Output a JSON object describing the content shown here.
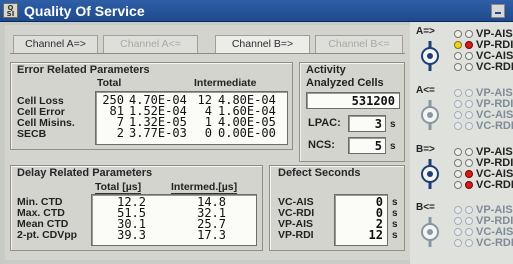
{
  "window": {
    "title": "Quality Of Service",
    "icon_text": "Q\nSI"
  },
  "tabs": [
    {
      "label": "Channel A=>",
      "state": "normal"
    },
    {
      "label": "Channel A<=",
      "state": "disabled"
    },
    {
      "label": "Channel B=>",
      "state": "active"
    },
    {
      "label": "Channel B<=",
      "state": "disabled"
    }
  ],
  "error": {
    "title": "Error Related Parameters",
    "col_total": "Total",
    "col_intermediate": "Intermediate",
    "rows": [
      {
        "label": "Cell Loss",
        "total_count": "250",
        "total_rate": "4.70E-04",
        "inter_count": "12",
        "inter_rate": "4.80E-04"
      },
      {
        "label": "Cell Error",
        "total_count": "81",
        "total_rate": "1.52E-04",
        "inter_count": "4",
        "inter_rate": "1.60E-04"
      },
      {
        "label": "Cell Misins.",
        "total_count": "7",
        "total_rate": "1.32E-05",
        "inter_count": "1",
        "inter_rate": "4.00E-05"
      },
      {
        "label": "SECB",
        "total_count": "2",
        "total_rate": "3.77E-03",
        "inter_count": "0",
        "inter_rate": "0.00E-00"
      }
    ]
  },
  "activity": {
    "title": "Activity",
    "analyzed_label": "Analyzed Cells",
    "analyzed_value": "531200",
    "lpac_label": "LPAC:",
    "lpac_value": "3",
    "ncs_label": "NCS:",
    "ncs_value": "5",
    "unit": "s"
  },
  "delay": {
    "title": "Delay Related Parameters",
    "col_total": "Total [µs]",
    "col_intermediate": "Intermed.[µs]",
    "rows": [
      {
        "label": "Min. CTD",
        "total": "12.2",
        "inter": "14.8"
      },
      {
        "label": "Max. CTD",
        "total": "51.5",
        "inter": "32.1"
      },
      {
        "label": "Mean CTD",
        "total": "30.1",
        "inter": "25.7"
      },
      {
        "label": "2-pt. CDVpp",
        "total": "39.3",
        "inter": "17.3"
      }
    ]
  },
  "defect": {
    "title": "Defect Seconds",
    "unit": "s",
    "rows": [
      {
        "label": "VC-AIS",
        "value": "0"
      },
      {
        "label": "VC-RDI",
        "value": "0"
      },
      {
        "label": "VP-AIS",
        "value": "2"
      },
      {
        "label": "VP-RDI",
        "value": "12"
      }
    ]
  },
  "indicators": [
    {
      "direction": "A=>",
      "dim": false,
      "signals": [
        {
          "label": "VP-AIS",
          "left": "off",
          "right": "off"
        },
        {
          "label": "VP-RDI",
          "left": "yellow",
          "right": "red"
        },
        {
          "label": "VC-AIS",
          "left": "off",
          "right": "off"
        },
        {
          "label": "VC-RDI",
          "left": "off",
          "right": "off"
        }
      ]
    },
    {
      "direction": "A<=",
      "dim": true,
      "signals": [
        {
          "label": "VP-AIS",
          "left": "off",
          "right": "off"
        },
        {
          "label": "VP-RDI",
          "left": "off",
          "right": "off"
        },
        {
          "label": "VC-AIS",
          "left": "off",
          "right": "off"
        },
        {
          "label": "VC-RDI",
          "left": "off",
          "right": "off"
        }
      ]
    },
    {
      "direction": "B=>",
      "dim": false,
      "signals": [
        {
          "label": "VP-AIS",
          "left": "off",
          "right": "off"
        },
        {
          "label": "VP-RDI",
          "left": "off",
          "right": "off"
        },
        {
          "label": "VC-AIS",
          "left": "off",
          "right": "red"
        },
        {
          "label": "VC-RDI",
          "left": "off",
          "right": "red"
        }
      ]
    },
    {
      "direction": "B<=",
      "dim": true,
      "signals": [
        {
          "label": "VP-AIS",
          "left": "off",
          "right": "off"
        },
        {
          "label": "VP-RDI",
          "left": "off",
          "right": "off"
        },
        {
          "label": "VC-AIS",
          "left": "off",
          "right": "off"
        },
        {
          "label": "VC-RDI",
          "left": "off",
          "right": "off"
        }
      ]
    }
  ],
  "colors": {
    "titlebar": "#1f4a8c",
    "panel": "#d4d4cf",
    "led_red": "#d11d1d",
    "led_yellow": "#f0d21e"
  }
}
